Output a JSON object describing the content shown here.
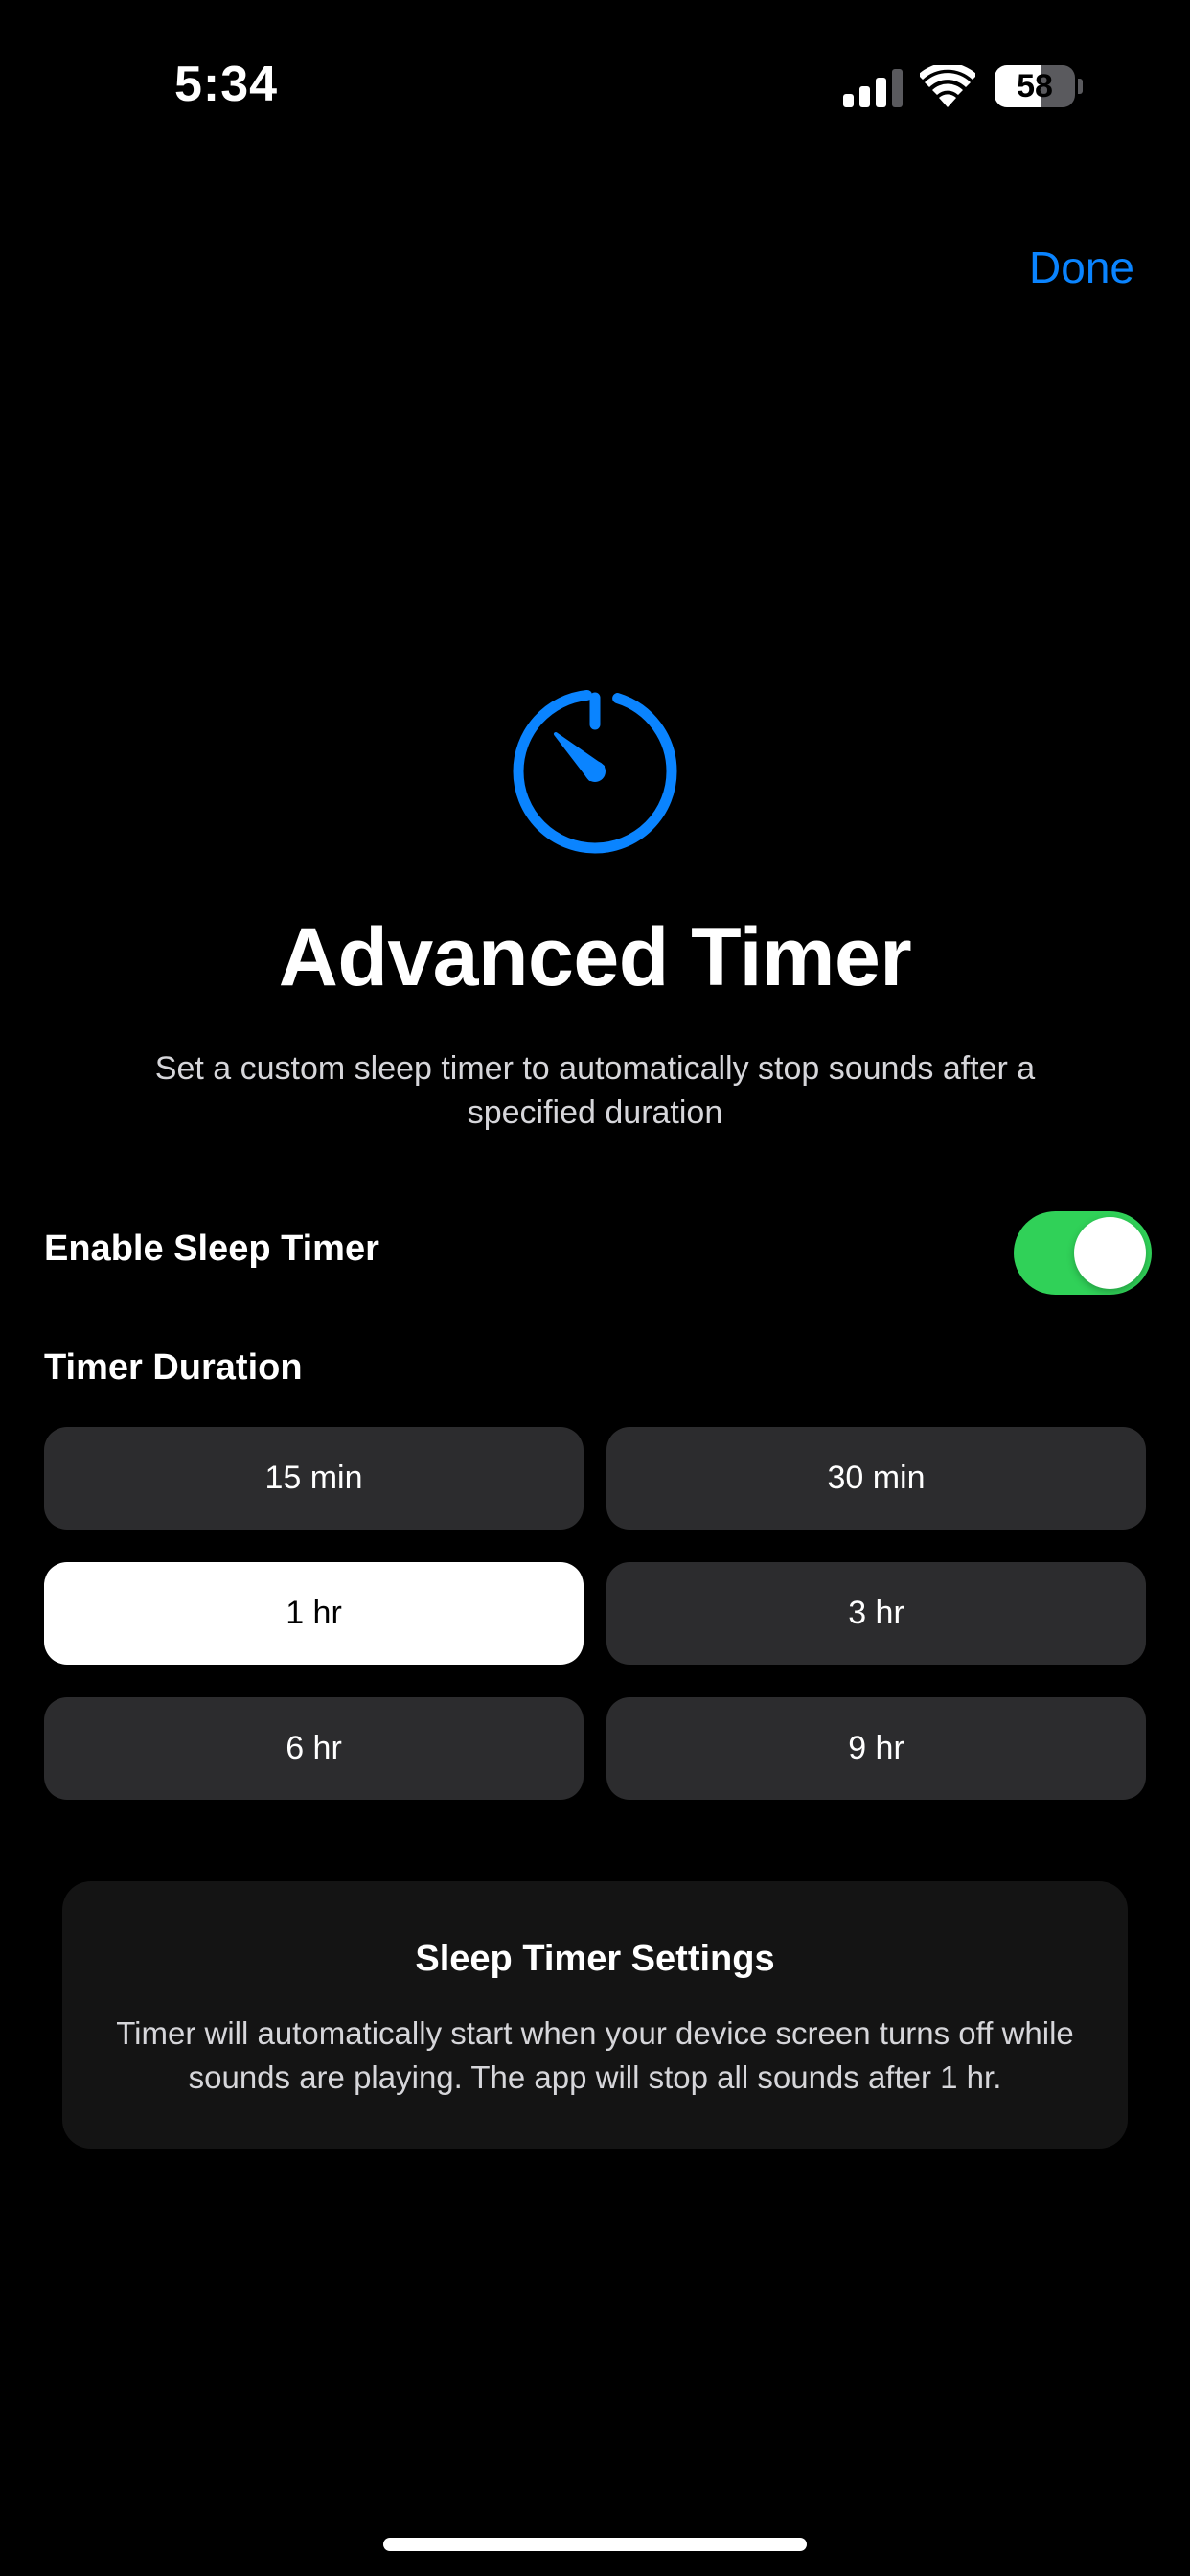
{
  "status_bar": {
    "time": "5:34",
    "battery_level": "58",
    "battery_fraction": 0.58,
    "icons": [
      "signal-icon",
      "wifi-icon",
      "battery-icon"
    ]
  },
  "nav": {
    "done_label": "Done"
  },
  "hero": {
    "icon": "timer-icon",
    "title": "Advanced Timer",
    "subtitle": "Set a custom sleep timer to automatically stop sounds after a specified duration"
  },
  "enable_timer": {
    "label": "Enable Sleep Timer",
    "enabled": true
  },
  "duration": {
    "heading": "Timer Duration",
    "options": [
      "15 min",
      "30 min",
      "1 hr",
      "3 hr",
      "6 hr",
      "9 hr"
    ],
    "selected": "1 hr"
  },
  "settings_card": {
    "title": "Sleep Timer Settings",
    "body": "Timer will automatically start when your device screen turns off while sounds are playing. The app will stop all sounds after 1 hr."
  },
  "colors": {
    "accent": "#0a84ff",
    "toggle_on": "#30d158",
    "background": "#000000",
    "option_bg": "#2c2c2e",
    "option_selected_bg": "#ffffff",
    "card_bg": "#141414"
  }
}
